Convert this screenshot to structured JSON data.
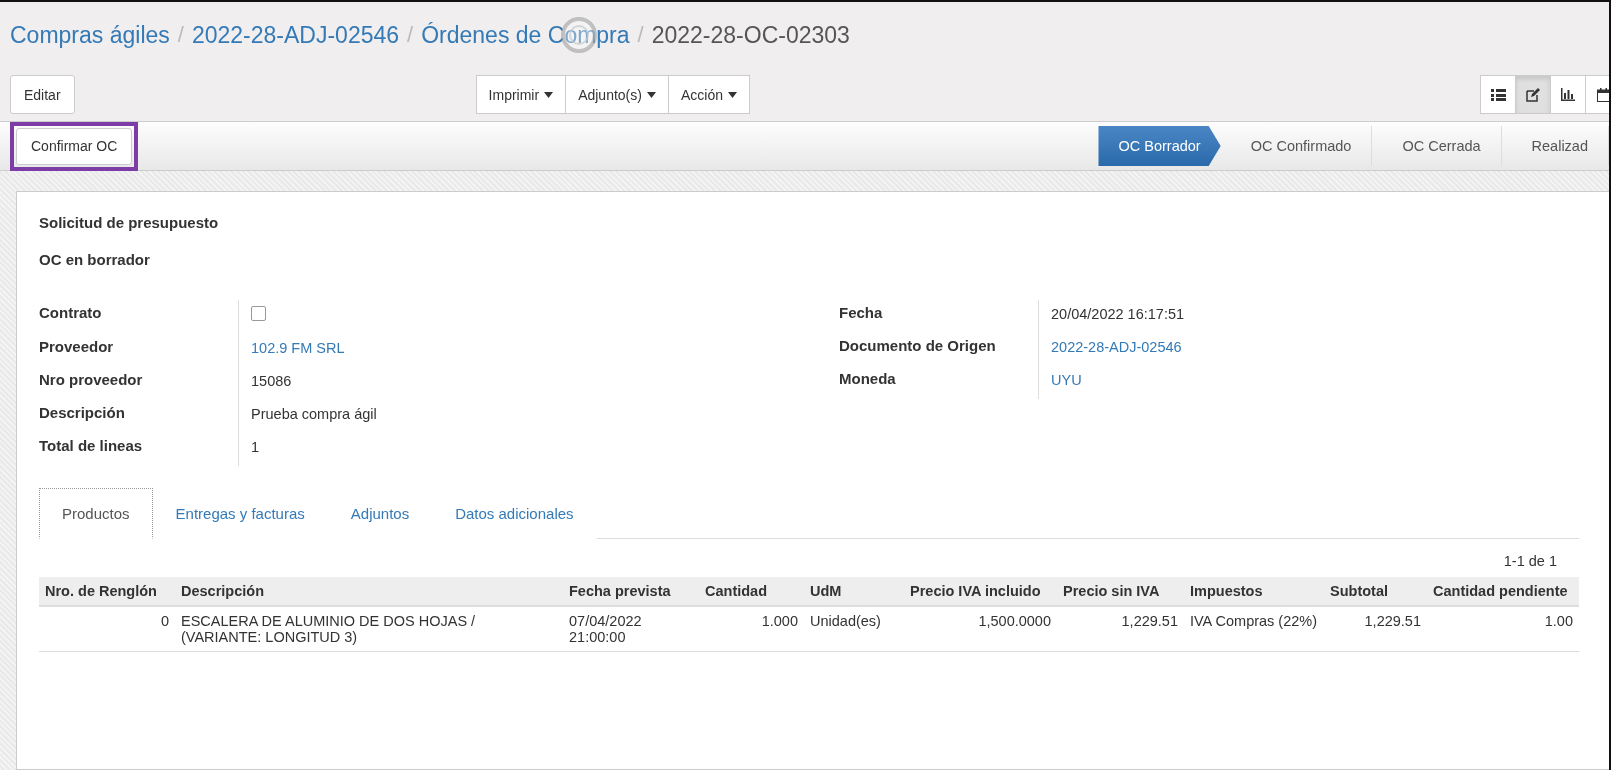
{
  "breadcrumb_separator": "/",
  "breadcrumbs": [
    {
      "label": "Compras ágiles",
      "kind": "link"
    },
    {
      "label": "2022-28-ADJ-02546",
      "kind": "link"
    },
    {
      "label": "Órdenes de Compra",
      "kind": "link"
    },
    {
      "label": "2022-28-OC-02303",
      "kind": "current"
    }
  ],
  "toolbar": {
    "edit_button": "Editar",
    "menus": [
      "Imprimir",
      "Adjunto(s)",
      "Acción"
    ],
    "views": [
      {
        "kind": "list",
        "selected": false
      },
      {
        "kind": "form",
        "selected": true
      },
      {
        "kind": "graph",
        "selected": false
      },
      {
        "kind": "calendar",
        "selected": false
      }
    ]
  },
  "statusbar": {
    "confirm_button": "Confirmar OC",
    "stages": [
      {
        "label": "OC Borrador",
        "selected": true
      },
      {
        "label": "OC Confirmado",
        "selected": false
      },
      {
        "label": "OC Cerrada",
        "selected": false
      },
      {
        "label": "Realizad",
        "selected": false
      }
    ]
  },
  "sheet": {
    "headings": [
      "Solicitud de presupuesto",
      "OC en borrador"
    ],
    "left_fields": [
      {
        "label": "Contrato",
        "kind": "checkbox",
        "checked": false
      },
      {
        "label": "Proveedor",
        "kind": "link",
        "value": "102.9 FM SRL"
      },
      {
        "label": "Nro proveedor",
        "kind": "text",
        "value": "15086"
      },
      {
        "label": "Descripción",
        "kind": "text",
        "value": "Prueba compra ágil"
      },
      {
        "label": "Total de lineas",
        "kind": "text",
        "value": "1"
      }
    ],
    "right_fields": [
      {
        "label": "Fecha",
        "kind": "text",
        "value": "20/04/2022 16:17:51"
      },
      {
        "label": "Documento de Origen",
        "kind": "link",
        "value": "2022-28-ADJ-02546"
      },
      {
        "label": "Moneda",
        "kind": "link",
        "value": "UYU"
      }
    ],
    "tabs": [
      {
        "label": "Productos",
        "selected": true
      },
      {
        "label": "Entregas y facturas",
        "selected": false
      },
      {
        "label": "Adjuntos",
        "selected": false
      },
      {
        "label": "Datos adicionales",
        "selected": false
      }
    ],
    "pager": "1-1 de 1",
    "table": {
      "columns": [
        "Nro. de Renglón",
        "Descripción",
        "Fecha prevista",
        "Cantidad",
        "UdM",
        "Precio IVA incluido",
        "Precio sin IVA",
        "Impuestos",
        "Subtotal",
        "Cantidad pendiente"
      ],
      "rows": [
        [
          "0",
          "ESCALERA DE ALUMINIO DE DOS HOJAS / (VARIANTE: LONGITUD 3)",
          "07/04/2022 21:00:00",
          "1.000",
          "Unidad(es)",
          "1,500.0000",
          "1,229.51",
          "IVA Compras (22%)",
          "1,229.51",
          "1.00"
        ]
      ]
    }
  }
}
